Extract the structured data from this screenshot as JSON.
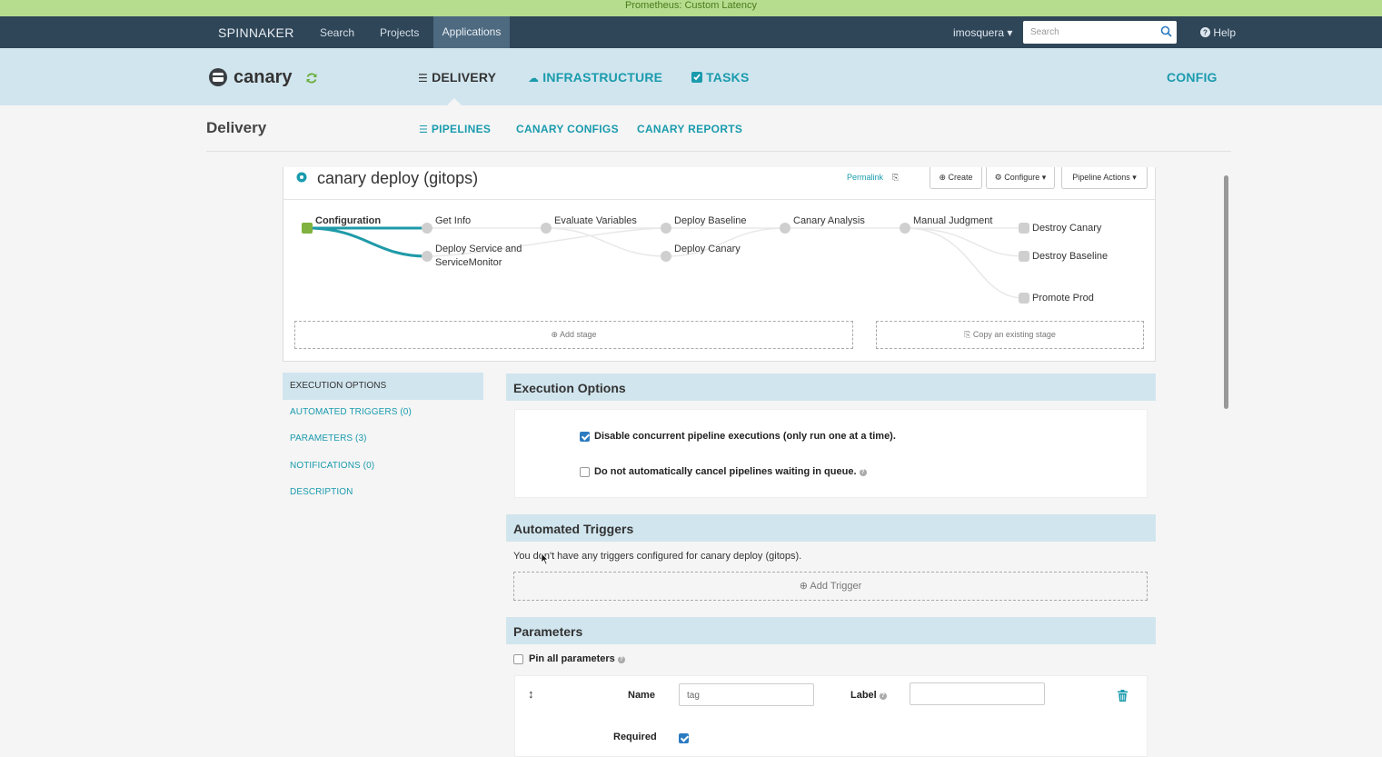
{
  "banner": {
    "text": "Prometheus: Custom Latency"
  },
  "topnav": {
    "brand": "SPINNAKER",
    "search": "Search",
    "projects": "Projects",
    "applications": "Applications",
    "user": "imosquera ▾",
    "search_placeholder": "Search",
    "help": "Help"
  },
  "app": {
    "name": "canary",
    "tabs": {
      "delivery": "DELIVERY",
      "infrastructure": "INFRASTRUCTURE",
      "tasks": "TASKS",
      "config": "CONFIG"
    }
  },
  "delivery": {
    "title": "Delivery",
    "tabs": {
      "pipelines": "PIPELINES",
      "canary_configs": "CANARY CONFIGS",
      "canary_reports": "CANARY REPORTS"
    }
  },
  "pipeline": {
    "name": "canary deploy (gitops)",
    "permalink": "Permalink",
    "create": "Create",
    "configure": "Configure ▾",
    "actions": "Pipeline Actions ▾",
    "stages": {
      "configuration": "Configuration",
      "get_info": "Get Info",
      "deploy_service_1": "Deploy Service and",
      "deploy_service_2": "ServiceMonitor",
      "evaluate_variables": "Evaluate Variables",
      "deploy_baseline": "Deploy Baseline",
      "deploy_canary": "Deploy Canary",
      "canary_analysis": "Canary Analysis",
      "manual_judgment": "Manual Judgment",
      "destroy_canary": "Destroy Canary",
      "destroy_baseline": "Destroy Baseline",
      "promote_prod": "Promote Prod"
    },
    "add_stage": "Add stage",
    "copy_stage": "Copy an existing stage"
  },
  "leftnav": {
    "execution_options": "EXECUTION OPTIONS",
    "automated_triggers": "AUTOMATED TRIGGERS (0)",
    "parameters": "PARAMETERS (3)",
    "notifications": "NOTIFICATIONS (0)",
    "description": "DESCRIPTION"
  },
  "execution_options": {
    "title": "Execution Options",
    "disable_concurrent": "Disable concurrent pipeline executions (only run one at a time).",
    "disable_concurrent_checked": true,
    "no_cancel": "Do not automatically cancel pipelines waiting in queue.",
    "no_cancel_checked": false
  },
  "automated_triggers": {
    "title": "Automated Triggers",
    "empty_text": "You don't have any triggers configured for canary deploy (gitops).",
    "add_trigger": "Add Trigger"
  },
  "parameters": {
    "title": "Parameters",
    "pin_all": "Pin all parameters",
    "name_label": "Name",
    "name_value": "tag",
    "label_label": "Label",
    "label_value": "",
    "required_label": "Required",
    "required_checked": true
  },
  "colors": {
    "accent": "#1a9bad",
    "nav_bg": "#2f4658",
    "banner_bg": "#b6dd8e",
    "app_bar_bg": "#d1e5ee",
    "checkbox": "#2b7bc0"
  }
}
